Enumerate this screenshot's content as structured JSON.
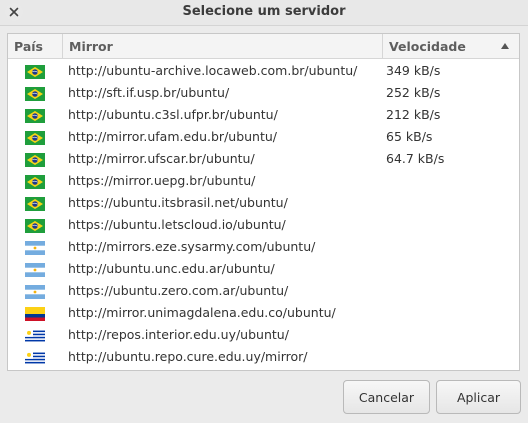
{
  "window": {
    "title": "Selecione um servidor"
  },
  "table": {
    "columns": {
      "country": "País",
      "mirror": "Mirror",
      "speed": "Velocidade"
    },
    "rows": [
      {
        "flag": "brazil",
        "url": "http://ubuntu-archive.locaweb.com.br/ubuntu/",
        "speed": "349 kB/s"
      },
      {
        "flag": "brazil",
        "url": "http://sft.if.usp.br/ubuntu/",
        "speed": "252 kB/s"
      },
      {
        "flag": "brazil",
        "url": "http://ubuntu.c3sl.ufpr.br/ubuntu/",
        "speed": "212 kB/s"
      },
      {
        "flag": "brazil",
        "url": "http://mirror.ufam.edu.br/ubuntu/",
        "speed": "65 kB/s"
      },
      {
        "flag": "brazil",
        "url": "http://mirror.ufscar.br/ubuntu/",
        "speed": "64.7 kB/s"
      },
      {
        "flag": "brazil",
        "url": "https://mirror.uepg.br/ubuntu/",
        "speed": ""
      },
      {
        "flag": "brazil",
        "url": "https://ubuntu.itsbrasil.net/ubuntu/",
        "speed": ""
      },
      {
        "flag": "brazil",
        "url": "https://ubuntu.letscloud.io/ubuntu/",
        "speed": ""
      },
      {
        "flag": "argentina",
        "url": "http://mirrors.eze.sysarmy.com/ubuntu/",
        "speed": ""
      },
      {
        "flag": "argentina",
        "url": "http://ubuntu.unc.edu.ar/ubuntu/",
        "speed": ""
      },
      {
        "flag": "argentina",
        "url": "https://ubuntu.zero.com.ar/ubuntu/",
        "speed": ""
      },
      {
        "flag": "colombia",
        "url": "http://mirror.unimagdalena.edu.co/ubuntu/",
        "speed": ""
      },
      {
        "flag": "uruguay",
        "url": "http://repos.interior.edu.uy/ubuntu/",
        "speed": ""
      },
      {
        "flag": "uruguay",
        "url": "http://ubuntu.repo.cure.edu.uy/mirror/",
        "speed": ""
      }
    ]
  },
  "buttons": {
    "cancel": "Cancelar",
    "apply": "Aplicar"
  },
  "colors": {
    "background": "#ebebeb",
    "list_background": "#ffffff",
    "brazil_green": "#1f9e3c",
    "brazil_yellow": "#f7d417",
    "brazil_blue": "#1e3a8c"
  }
}
